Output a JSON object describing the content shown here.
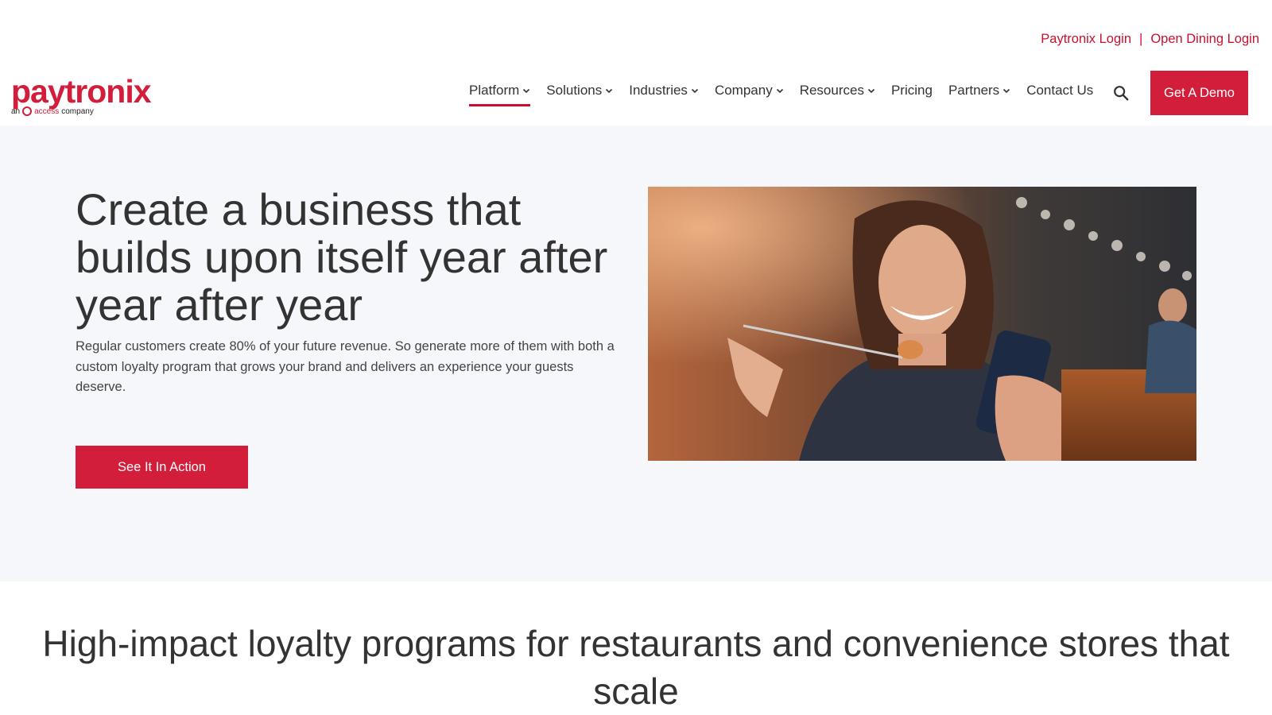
{
  "top_links": {
    "paytronix_login": "Paytronix Login",
    "separator": "|",
    "open_dining_login": "Open Dining Login"
  },
  "logo": {
    "wordmark": "paytronix",
    "tagline_prefix": "an",
    "tagline_access": "access",
    "tagline_suffix": "company"
  },
  "nav": {
    "items": [
      {
        "label": "Platform",
        "has_dropdown": true,
        "active": true
      },
      {
        "label": "Solutions",
        "has_dropdown": true
      },
      {
        "label": "Industries",
        "has_dropdown": true
      },
      {
        "label": "Company",
        "has_dropdown": true
      },
      {
        "label": "Resources",
        "has_dropdown": true
      },
      {
        "label": "Pricing",
        "has_dropdown": false
      },
      {
        "label": "Partners",
        "has_dropdown": true
      },
      {
        "label": "Contact Us",
        "has_dropdown": false
      }
    ],
    "search_icon": "search-icon",
    "demo_button": "Get A Demo"
  },
  "hero": {
    "title": "Create a business that builds upon itself year after year after year",
    "description": "Regular customers create 80% of your future revenue. So generate more of them with both a custom loyalty program that grows your brand and delivers an experience your guests deserve.",
    "cta": "See It In Action"
  },
  "section": {
    "title": "High-impact loyalty programs for restaurants and convenience stores that scale"
  },
  "colors": {
    "brand_red": "#d21d3b",
    "hero_bg": "#f6f7fb",
    "text": "#333333"
  }
}
